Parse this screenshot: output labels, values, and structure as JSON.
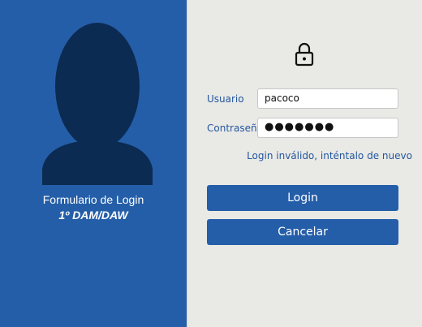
{
  "brand": {
    "title": "Formulario de Login",
    "subtitle": "1º DAM/DAW"
  },
  "icons": {
    "avatar": "user-silhouette-icon",
    "lock": "lock-icon"
  },
  "colors": {
    "panel": "#255ea8",
    "accent": "#2457a0",
    "background": "#e9e9e5"
  },
  "form": {
    "user_label": "Usuario",
    "user_value": "pacoco",
    "password_label": "Contraseña",
    "password_value": "●●●●●●●",
    "error": "Login inválido, inténtalo de nuevo"
  },
  "buttons": {
    "login": "Login",
    "cancel": "Cancelar"
  }
}
